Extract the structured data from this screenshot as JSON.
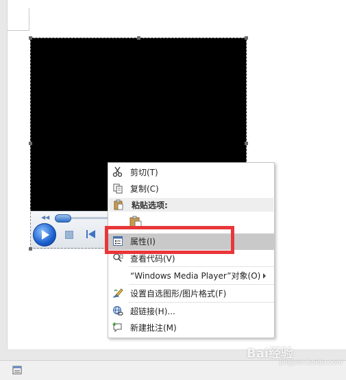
{
  "context_menu": {
    "items": [
      {
        "label": "剪切(T)",
        "icon": "scissors-icon"
      },
      {
        "label": "复制(C)",
        "icon": "copy-icon"
      },
      {
        "label": "粘贴选项:",
        "icon": "clipboard-icon",
        "header": true
      },
      {
        "label": "",
        "icon": "paste-icon"
      },
      {
        "label": "属性(I)",
        "icon": "properties-icon",
        "highlighted": true
      },
      {
        "label": "查看代码(V)",
        "icon": "view-code-icon"
      },
      {
        "label": "“Windows Media Player”对象(O)",
        "icon": "",
        "submenu": true
      },
      {
        "label": "设置自选图形/图片格式(F)",
        "icon": "format-shape-icon"
      },
      {
        "label": "超链接(H)...",
        "icon": "hyperlink-icon"
      },
      {
        "label": "新建批注(M)",
        "icon": "new-comment-icon"
      }
    ]
  },
  "watermark": {
    "text": "Bai经验",
    "sub": "jingyan.baidu.com"
  },
  "colors": {
    "highlight_box": "#e8373a",
    "menu_highlight": "#c9c9c9",
    "player_accent": "#1a5fcf"
  }
}
